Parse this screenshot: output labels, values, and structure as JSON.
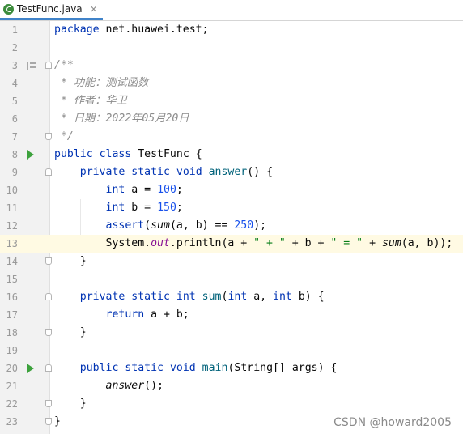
{
  "tab": {
    "title": "TestFunc.java",
    "close": "×",
    "icon": "java-class-icon"
  },
  "watermark": "CSDN @howard2005",
  "line_numbers": [
    "1",
    "2",
    "3",
    "4",
    "5",
    "6",
    "7",
    "8",
    "9",
    "10",
    "11",
    "12",
    "13",
    "14",
    "15",
    "16",
    "17",
    "18",
    "19",
    "20",
    "21",
    "22",
    "23"
  ],
  "current_line": 13,
  "code": {
    "l1": {
      "a": "package",
      "b": " net.huawei.test;"
    },
    "l3": "/**",
    "l4": " * 功能：测试函数",
    "l5": " * 作者：华卫",
    "l6": " * 日期：2022年05月20日",
    "l7": " */",
    "l8": {
      "a": "public",
      "b": " ",
      "c": "class",
      "d": " TestFunc {"
    },
    "l9": {
      "a": "    ",
      "b": "private",
      "c": " ",
      "d": "static",
      "e": " ",
      "f": "void",
      "g": " ",
      "h": "answer",
      "i": "() {"
    },
    "l10": {
      "a": "        ",
      "b": "int",
      "c": " a = ",
      "d": "100",
      "e": ";"
    },
    "l11": {
      "a": "        ",
      "b": "int",
      "c": " b = ",
      "d": "150",
      "e": ";"
    },
    "l12": {
      "a": "        ",
      "b": "assert",
      "c": "(",
      "d": "sum",
      "e": "(a, b) == ",
      "f": "250",
      "g": ");"
    },
    "l13": {
      "a": "        System.",
      "b": "out",
      "c": ".println(a + ",
      "d": "\" + \"",
      "e": " + b + ",
      "f": "\" = \"",
      "g": " + ",
      "h": "sum",
      "i": "(a, b));"
    },
    "l14": "    }",
    "l16": {
      "a": "    ",
      "b": "private",
      "c": " ",
      "d": "static",
      "e": " ",
      "f": "int",
      "g": " ",
      "h": "sum",
      "i": "(",
      "j": "int",
      "k": " a, ",
      "l": "int",
      "m": " b) {"
    },
    "l17": {
      "a": "        ",
      "b": "return",
      "c": " a + b;"
    },
    "l18": "    }",
    "l20": {
      "a": "    ",
      "b": "public",
      "c": " ",
      "d": "static",
      "e": " ",
      "f": "void",
      "g": " ",
      "h": "main",
      "i": "(String[] args) {"
    },
    "l21": {
      "a": "        ",
      "b": "answer",
      "c": "();"
    },
    "l22": "    }",
    "l23": "}"
  },
  "colors": {
    "keyword": "#0033b3",
    "number": "#1750eb",
    "string": "#067d17",
    "function": "#00627a",
    "comment": "#8c8c8c",
    "field": "#871094",
    "current_line_bg": "#fffae3",
    "gutter_bg": "#f2f2f2",
    "run_icon": "#3da23d"
  },
  "gutter_icons": {
    "run": "run-gutter-icon",
    "fold": "fold-icon",
    "doc": "rendered-doc-icon"
  }
}
